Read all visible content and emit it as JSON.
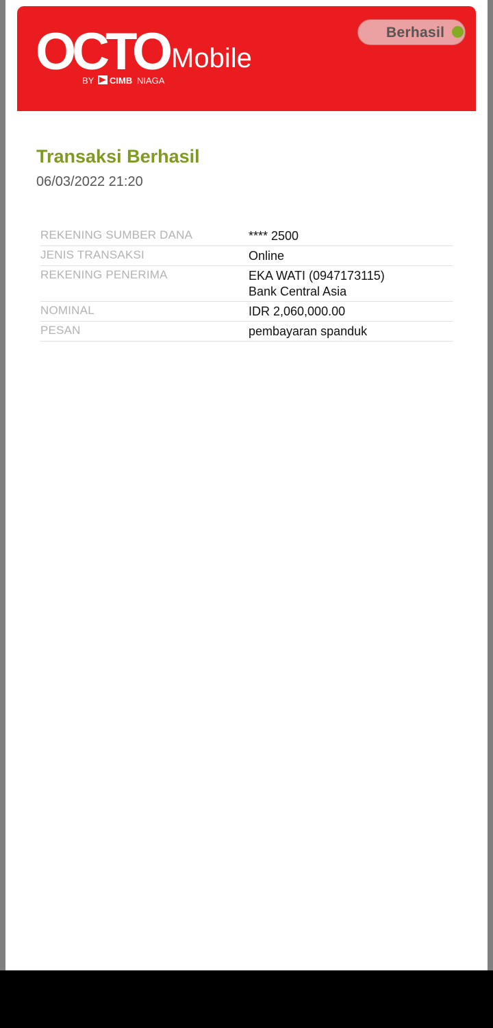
{
  "header": {
    "logo": {
      "brand": "OCTO",
      "product": "Mobile",
      "byline_prefix": "BY",
      "byline_bank": "CIMB",
      "byline_suffix": "NIAGA"
    },
    "status": {
      "label": "Berhasil",
      "dot_color": "#84ab24"
    },
    "brand_color": "#ea1c1f"
  },
  "transaction": {
    "title": "Transaksi Berhasil",
    "datetime": "06/03/2022 21:20"
  },
  "details": [
    {
      "label": "REKENING SUMBER DANA",
      "value": "**** 2500",
      "value2": ""
    },
    {
      "label": "JENIS TRANSAKSI",
      "value": "Online",
      "value2": ""
    },
    {
      "label": "REKENING PENERIMA",
      "value": "EKA WATI  (0947173115)",
      "value2": "Bank Central Asia"
    },
    {
      "label": "NOMINAL",
      "value": "IDR 2,060,000.00",
      "value2": ""
    },
    {
      "label": "PESAN",
      "value": "pembayaran spanduk",
      "value2": ""
    }
  ]
}
